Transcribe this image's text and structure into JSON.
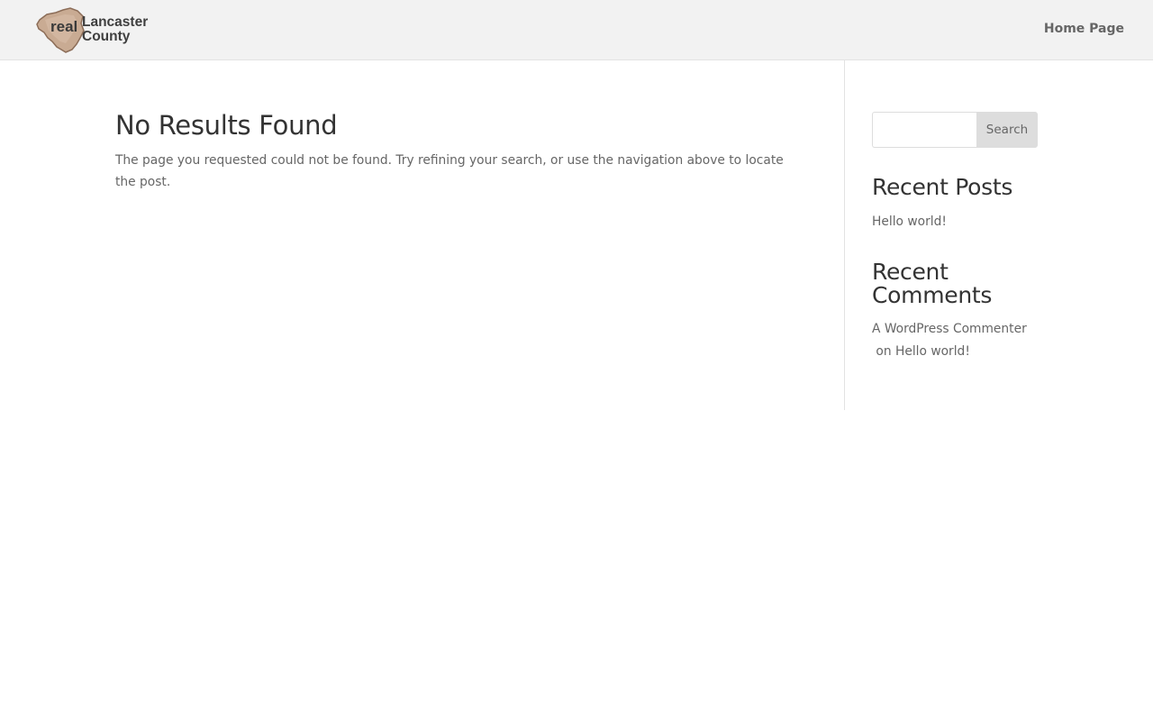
{
  "header": {
    "logo": {
      "word_real": "real",
      "line1": "Lancaster",
      "line2": "County",
      "icon": "county-map-logo-icon"
    },
    "nav": {
      "home_label": "Home Page"
    }
  },
  "main": {
    "title": "No Results Found",
    "message": "The page you requested could not be found. Try refining your search, or use the navigation above to locate the post."
  },
  "sidebar": {
    "search": {
      "placeholder": "",
      "value": "",
      "button_label": "Search"
    },
    "recent_posts": {
      "title": "Recent Posts",
      "items": [
        {
          "label": "Hello world!"
        }
      ]
    },
    "recent_comments": {
      "title": "Recent Comments",
      "items": [
        {
          "author": "A WordPress Commenter",
          "connector": " on ",
          "post": "Hello world!"
        }
      ]
    }
  },
  "colors": {
    "header_bg": "#f2f2f2",
    "heading_text": "#333333",
    "body_text": "#666666",
    "button_bg": "#dddddd",
    "divider": "#e2e2e2"
  }
}
